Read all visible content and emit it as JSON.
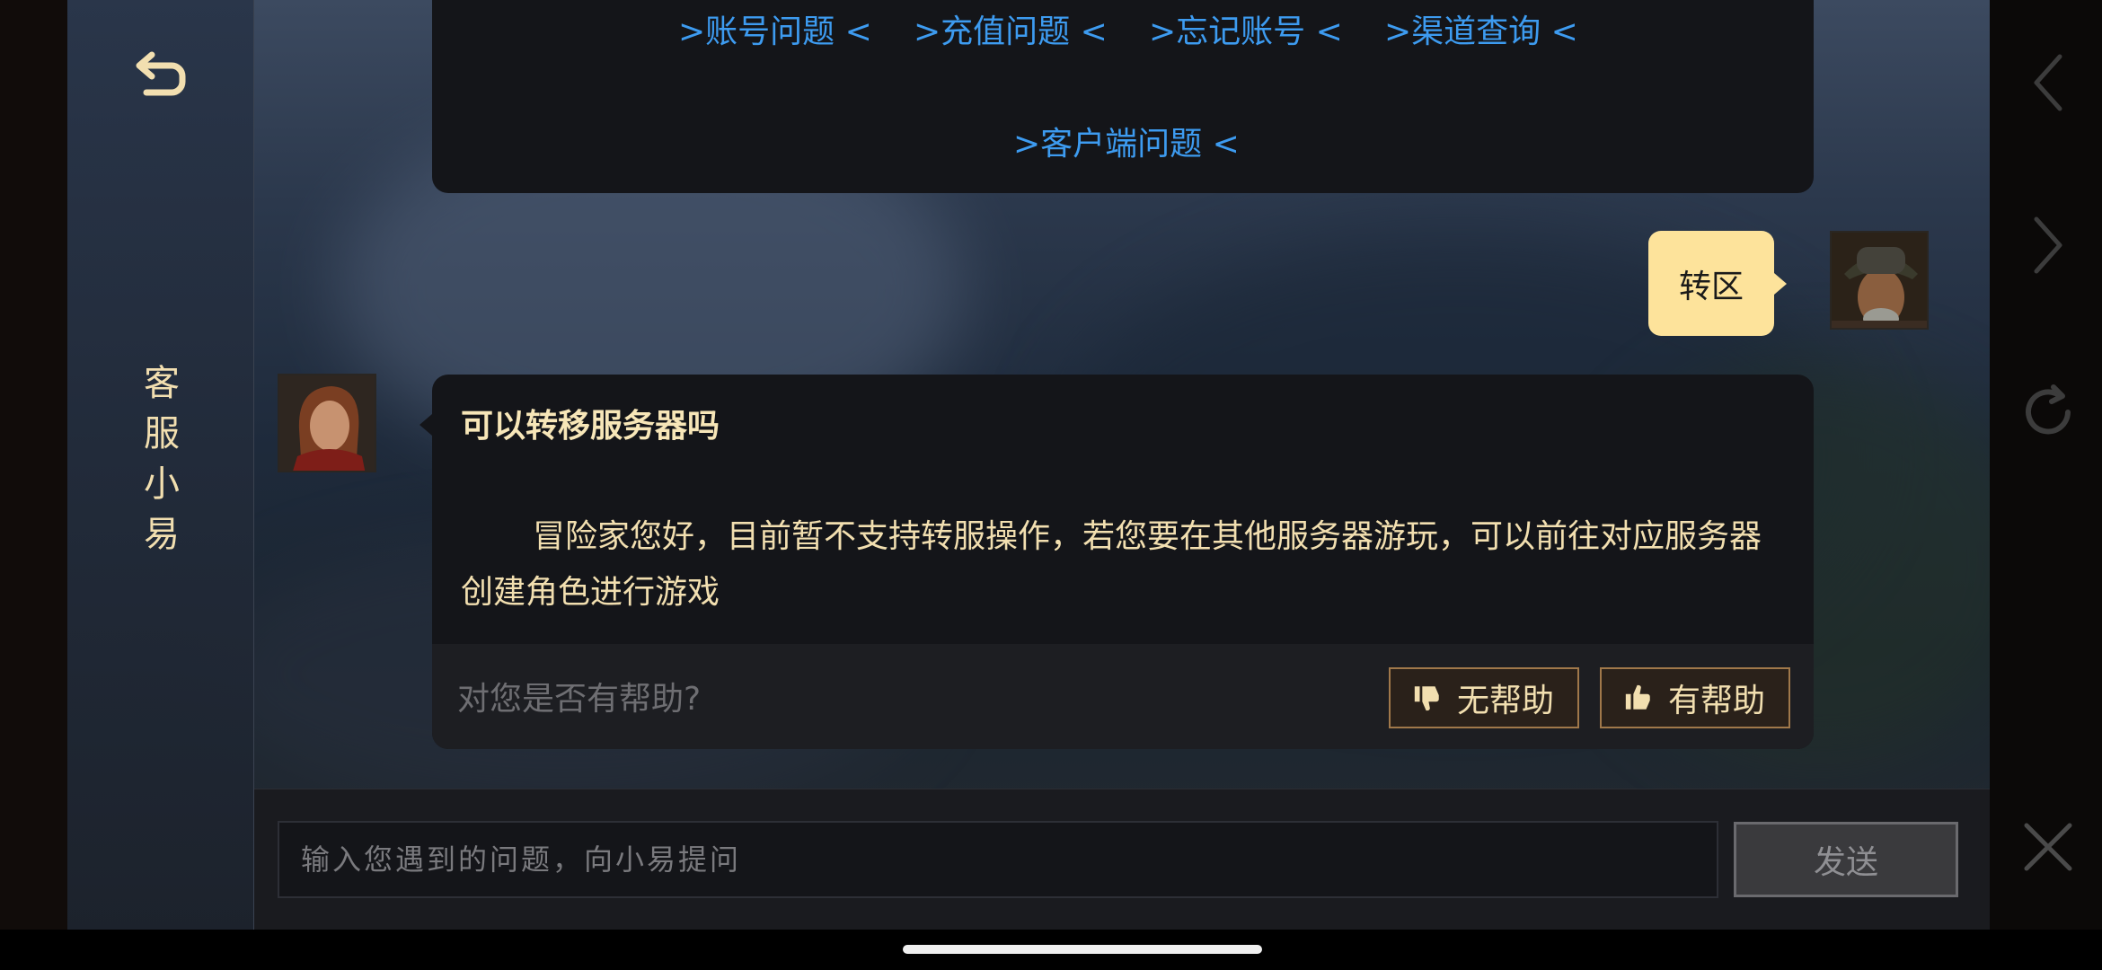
{
  "sidebar": {
    "back_icon": "return-arrow-icon",
    "title_chars": [
      "客",
      "服",
      "小",
      "易"
    ]
  },
  "quick_links": {
    "row1": [
      ">账号问题 <",
      ">充值问题 <",
      ">忘记账号 <",
      ">渠道查询 <"
    ],
    "row2": ">客户端问题 <"
  },
  "user_message": {
    "text": "转区"
  },
  "bot_reply": {
    "title": "可以转移服务器吗",
    "body": "冒险家您好，目前暂不支持转服操作，若您要在其他服务器游玩，可以前往对应服务器创建角色进行游戏",
    "feedback_question": "对您是否有帮助?",
    "not_helpful_label": "无帮助",
    "helpful_label": "有帮助"
  },
  "input": {
    "placeholder": "输入您遇到的问题，向小易提问",
    "send_label": "发送"
  },
  "right_nav": {
    "icons": [
      "back-chevron-icon",
      "forward-chevron-icon",
      "refresh-icon",
      "close-icon"
    ]
  },
  "colors": {
    "link": "#3d9bf0",
    "accent_text": "#f2dfb0",
    "user_bubble": "#fde39b",
    "bubble_bg": "#141519"
  }
}
